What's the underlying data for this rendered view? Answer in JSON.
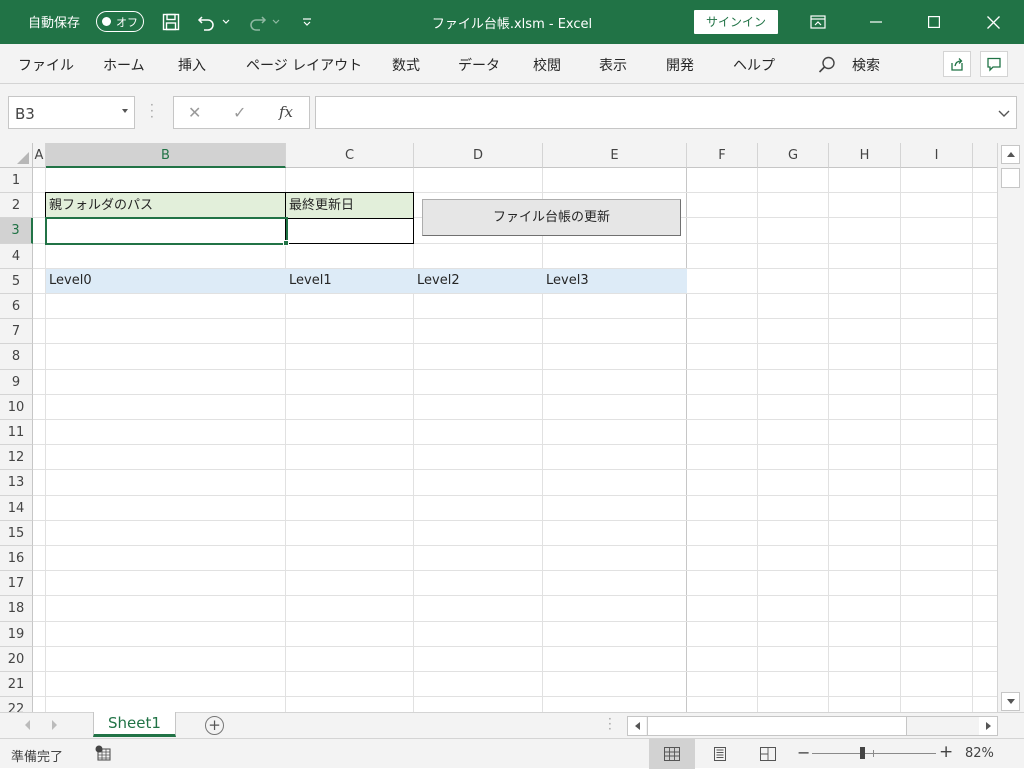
{
  "titlebar": {
    "autosave_label": "自動保存",
    "autosave_state": "オフ",
    "doc_title": "ファイル台帳.xlsm  -  Excel",
    "signin": "サインイン",
    "icons": [
      "save-icon",
      "undo-icon",
      "redo-icon",
      "customize-icon",
      "ribbon-display-icon",
      "minimize-icon",
      "maximize-icon",
      "close-icon"
    ]
  },
  "ribbon": {
    "tabs": [
      "ファイル",
      "ホーム",
      "挿入",
      "ページ レイアウト",
      "数式",
      "データ",
      "校閲",
      "表示",
      "開発",
      "ヘルプ"
    ],
    "search_label": "検索"
  },
  "formula_bar": {
    "name_box": "B3",
    "fx": "fx",
    "formula": ""
  },
  "sheet": {
    "columns": [
      "A",
      "B",
      "C",
      "D",
      "E",
      "F",
      "G",
      "H",
      "I"
    ],
    "selected_column": "B",
    "rows": [
      "1",
      "2",
      "3",
      "4",
      "5",
      "6",
      "7",
      "8",
      "9",
      "10",
      "11",
      "12",
      "13",
      "14",
      "15",
      "16",
      "17",
      "18",
      "19",
      "20",
      "21",
      "22"
    ],
    "selected_row": "3",
    "cells": {
      "B2": "親フォルダのパス",
      "C2": "最終更新日",
      "B5": "Level0",
      "C5": "Level1",
      "D5": "Level2",
      "E5": "Level3"
    },
    "header_colors": {
      "green": "#e2efda",
      "blue": "#ddebf7"
    },
    "button_label": "ファイル台帳の更新"
  },
  "tabs": {
    "sheets": [
      "Sheet1"
    ],
    "active_sheet": "Sheet1"
  },
  "statusbar": {
    "status": "準備完了",
    "zoom": "82%",
    "zoom_percent": 82
  },
  "colors": {
    "accent": "#217346",
    "chrome": "#f3f3f3"
  }
}
